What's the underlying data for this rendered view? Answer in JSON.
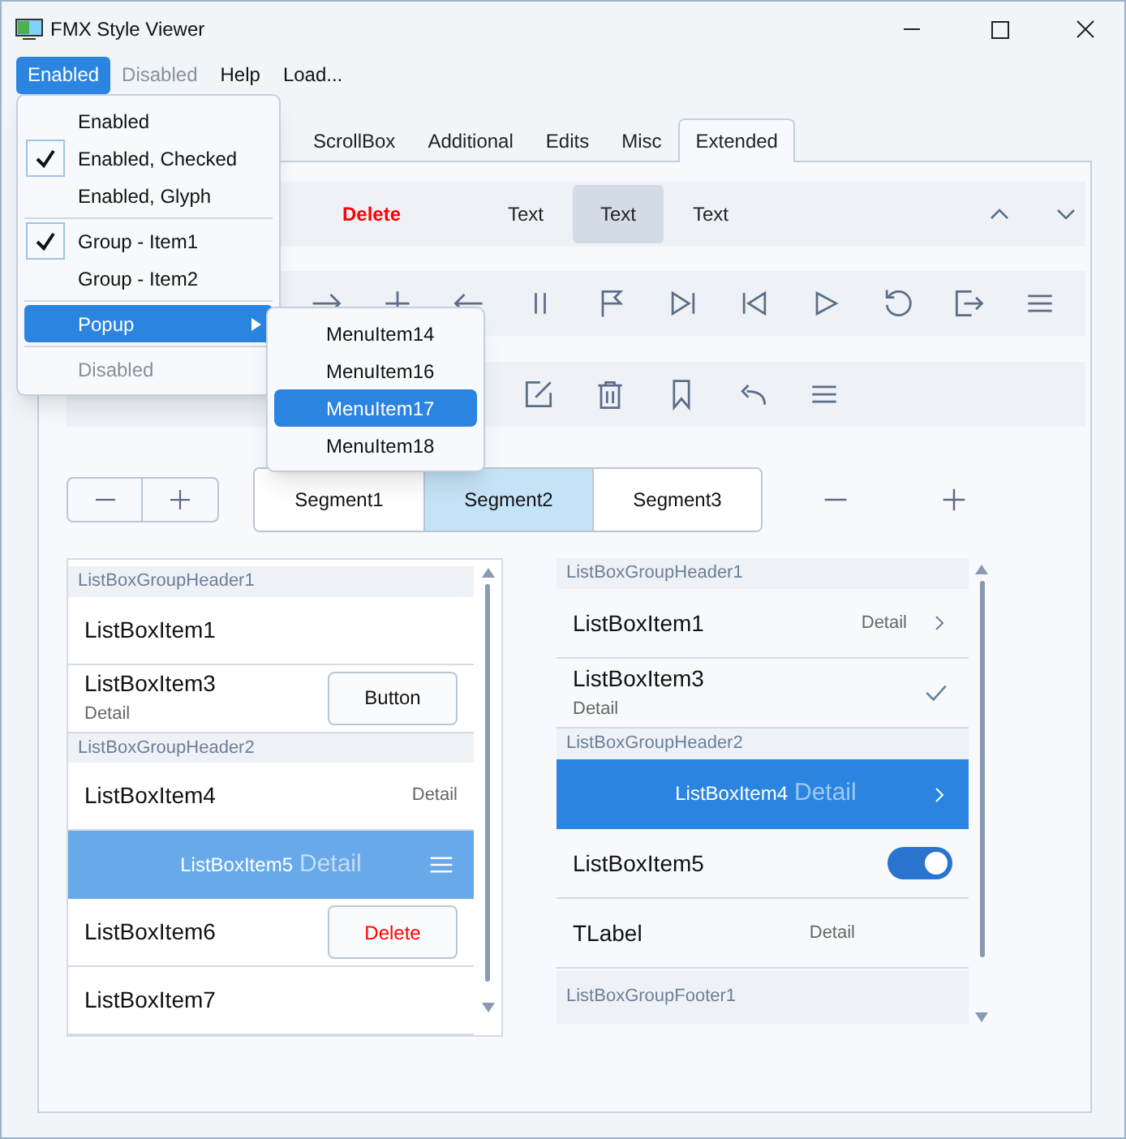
{
  "window": {
    "title": "FMX Style Viewer"
  },
  "menu_bar": [
    {
      "label": "Enabled",
      "selected": true,
      "disabled": false
    },
    {
      "label": "Disabled",
      "selected": false,
      "disabled": true
    },
    {
      "label": "Help",
      "selected": false,
      "disabled": false
    },
    {
      "label": "Load...",
      "selected": false,
      "disabled": false
    }
  ],
  "dropdown_menu": [
    {
      "kind": "item",
      "label": "Enabled",
      "checked": false,
      "selected": false,
      "disabled": false
    },
    {
      "kind": "item",
      "label": "Enabled, Checked",
      "checked": true,
      "selected": false,
      "disabled": false
    },
    {
      "kind": "item",
      "label": "Enabled, Glyph",
      "checked": false,
      "selected": false,
      "disabled": false
    },
    {
      "kind": "separator"
    },
    {
      "kind": "item",
      "label": "Group - Item1",
      "checked": true,
      "selected": false,
      "disabled": false
    },
    {
      "kind": "item",
      "label": "Group - Item2",
      "checked": false,
      "selected": false,
      "disabled": false
    },
    {
      "kind": "separator"
    },
    {
      "kind": "submenu",
      "label": "Popup",
      "checked": false,
      "selected": true,
      "disabled": false
    },
    {
      "kind": "separator"
    },
    {
      "kind": "item",
      "label": "Disabled",
      "checked": false,
      "selected": false,
      "disabled": true
    }
  ],
  "submenu": [
    {
      "label": "MenuItem14",
      "selected": false
    },
    {
      "label": "MenuItem16",
      "selected": false
    },
    {
      "label": "MenuItem17",
      "selected": true
    },
    {
      "label": "MenuItem18",
      "selected": false
    }
  ],
  "tabs": [
    {
      "label": "ScrollBox",
      "selected": false
    },
    {
      "label": "Additional",
      "selected": false
    },
    {
      "label": "Edits",
      "selected": false
    },
    {
      "label": "Misc",
      "selected": false
    },
    {
      "label": "Extended",
      "selected": true
    }
  ],
  "toolbar": [
    {
      "kind": "destructive",
      "label": "Delete",
      "selected": false
    },
    {
      "kind": "text",
      "label": "Text",
      "selected": false
    },
    {
      "kind": "text",
      "label": "Text",
      "selected": true
    },
    {
      "kind": "text",
      "label": "Text",
      "selected": false
    }
  ],
  "segments": [
    {
      "label": "Segment1",
      "selected": false
    },
    {
      "label": "Segment2",
      "selected": true
    },
    {
      "label": "Segment3",
      "selected": false
    }
  ],
  "left_list": [
    {
      "kind": "header",
      "label": "ListBoxGroupHeader1"
    },
    {
      "kind": "item",
      "label": "ListBoxItem1",
      "selected": false
    },
    {
      "kind": "item",
      "label": "ListBoxItem3",
      "detail": {
        "kind": "below",
        "text": "Detail"
      },
      "accessory": {
        "kind": "button",
        "label": "Button"
      },
      "selected": false
    },
    {
      "kind": "header",
      "label": "ListBoxGroupHeader2"
    },
    {
      "kind": "item",
      "label": "ListBoxItem4",
      "detail": {
        "kind": "right",
        "text": "Detail"
      },
      "selected": false
    },
    {
      "kind": "item",
      "label": "ListBoxItem5",
      "detail": {
        "kind": "inline",
        "text": "Detail"
      },
      "accessory": {
        "kind": "menu"
      },
      "selected": true
    },
    {
      "kind": "item",
      "label": "ListBoxItem6",
      "accessory": {
        "kind": "delete",
        "label": "Delete"
      },
      "selected": false
    },
    {
      "kind": "item",
      "label": "ListBoxItem7",
      "selected": false
    }
  ],
  "right_list": [
    {
      "kind": "header",
      "label": "ListBoxGroupHeader1"
    },
    {
      "kind": "item",
      "label": "ListBoxItem1",
      "detail": {
        "kind": "right",
        "text": "Detail"
      },
      "accessory": {
        "kind": "chevron"
      },
      "selected": false
    },
    {
      "kind": "item",
      "label": "ListBoxItem3",
      "detail": {
        "kind": "below",
        "text": "Detail"
      },
      "accessory": {
        "kind": "check"
      },
      "selected": false
    },
    {
      "kind": "header",
      "label": "ListBoxGroupHeader2"
    },
    {
      "kind": "item",
      "label": "ListBoxItem4",
      "detail": {
        "kind": "inline",
        "text": "Detail"
      },
      "accessory": {
        "kind": "chevron"
      },
      "selected": true
    },
    {
      "kind": "item",
      "label": "ListBoxItem5",
      "accessory": {
        "kind": "switch",
        "on": true
      },
      "selected": false
    },
    {
      "kind": "item",
      "label": "TLabel",
      "detail": {
        "kind": "middle",
        "text": "Detail"
      },
      "selected": false
    },
    {
      "kind": "footer",
      "label": "ListBoxGroupFooter1"
    }
  ]
}
